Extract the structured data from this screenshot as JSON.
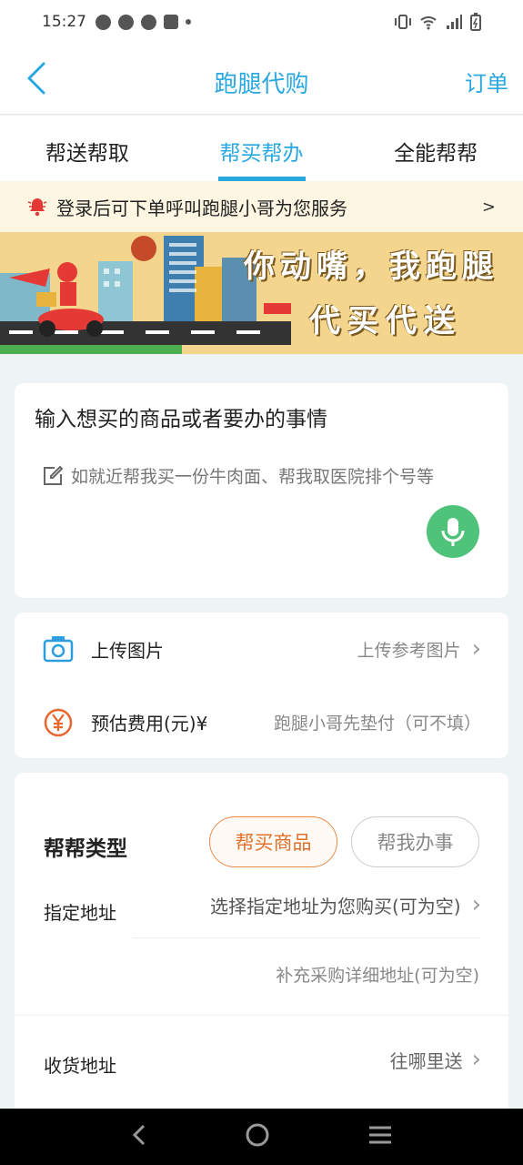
{
  "status_bar": {
    "time": "15:27"
  },
  "header": {
    "title": "跑腿代购",
    "right_action": "订单"
  },
  "tabs": [
    {
      "label": "帮送帮取",
      "active": false
    },
    {
      "label": "帮买帮办",
      "active": true
    },
    {
      "label": "全能帮帮",
      "active": false
    }
  ],
  "notice": {
    "text": "登录后可下单呼叫跑腿小哥为您服务",
    "arrow": ">"
  },
  "banner": {
    "line1": "你动嘴，我跑腿",
    "line2": "代买代送"
  },
  "request_card": {
    "heading": "输入想买的商品或者要办的事情",
    "placeholder": "如就近帮我买一份牛肉面、帮我取医院排个号等"
  },
  "options_card": {
    "upload": {
      "label": "上传图片",
      "value": "上传参考图片"
    },
    "fee": {
      "label": "预估费用(元)¥",
      "placeholder": "跑腿小哥先垫付（可不填）"
    }
  },
  "type_card": {
    "type_label": "帮帮类型",
    "type_options": [
      {
        "label": "帮买商品",
        "selected": true
      },
      {
        "label": "帮我办事",
        "selected": false
      }
    ],
    "address_label": "指定地址",
    "address_value": "选择指定地址为您购买(可为空)",
    "detail_placeholder": "补充采购详细地址(可为空)",
    "receive_label": "收货地址",
    "receive_value": "往哪里送"
  },
  "colors": {
    "accent": "#29a8e0",
    "orange": "#e0702a",
    "mic_green": "#4fc37a"
  }
}
